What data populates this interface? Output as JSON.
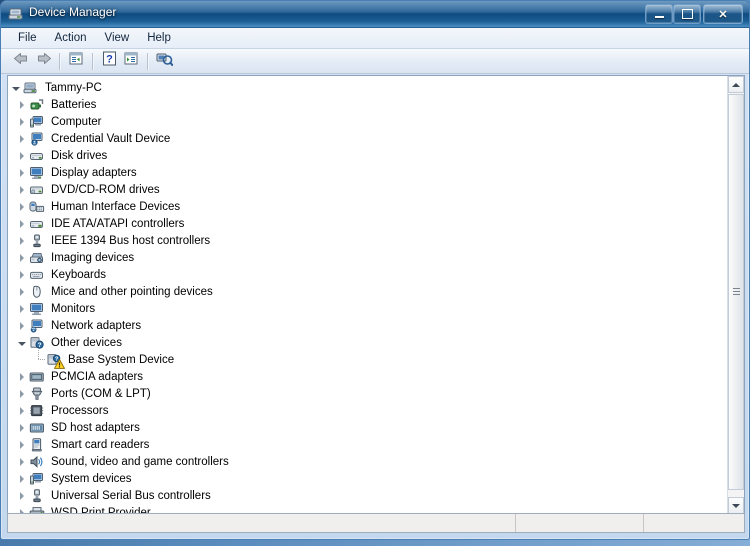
{
  "window": {
    "title": "Device Manager",
    "title_icon": "device-manager-icon",
    "buttons": {
      "minimize": "minimize-icon",
      "maximize": "maximize-icon",
      "close": "✕"
    }
  },
  "menubar": {
    "items": [
      {
        "label": "File"
      },
      {
        "label": "Action"
      },
      {
        "label": "View"
      },
      {
        "label": "Help"
      }
    ]
  },
  "toolbar": {
    "buttons": [
      {
        "name": "back-button",
        "icon": "back-arrow-icon"
      },
      {
        "name": "forward-button",
        "icon": "forward-arrow-icon"
      },
      {
        "name": "properties-button",
        "icon": "properties-icon"
      },
      {
        "name": "help-button",
        "icon": "help-question-icon"
      },
      {
        "name": "show-hidden-button",
        "icon": "list-panel-icon"
      },
      {
        "name": "scan-hardware-button",
        "icon": "scan-hardware-icon"
      }
    ]
  },
  "tree": {
    "root": {
      "label": "Tammy-PC",
      "icon": "computer-root-icon",
      "expanded": true
    },
    "nodes": [
      {
        "label": "Batteries",
        "icon": "battery-icon",
        "expanded": false,
        "leaf": false
      },
      {
        "label": "Computer",
        "icon": "computer-icon",
        "expanded": false,
        "leaf": false
      },
      {
        "label": "Credential Vault Device",
        "icon": "credential-icon",
        "expanded": false,
        "leaf": false
      },
      {
        "label": "Disk drives",
        "icon": "disk-drive-icon",
        "expanded": false,
        "leaf": false
      },
      {
        "label": "Display adapters",
        "icon": "display-icon",
        "expanded": false,
        "leaf": false
      },
      {
        "label": "DVD/CD-ROM drives",
        "icon": "dvd-icon",
        "expanded": false,
        "leaf": false
      },
      {
        "label": "Human Interface Devices",
        "icon": "hid-icon",
        "expanded": false,
        "leaf": false
      },
      {
        "label": "IDE ATA/ATAPI controllers",
        "icon": "ide-icon",
        "expanded": false,
        "leaf": false
      },
      {
        "label": "IEEE 1394 Bus host controllers",
        "icon": "ieee1394-icon",
        "expanded": false,
        "leaf": false
      },
      {
        "label": "Imaging devices",
        "icon": "imaging-icon",
        "expanded": false,
        "leaf": false
      },
      {
        "label": "Keyboards",
        "icon": "keyboard-icon",
        "expanded": false,
        "leaf": false
      },
      {
        "label": "Mice and other pointing devices",
        "icon": "mouse-icon",
        "expanded": false,
        "leaf": false
      },
      {
        "label": "Monitors",
        "icon": "monitor-icon",
        "expanded": false,
        "leaf": false
      },
      {
        "label": "Network adapters",
        "icon": "network-icon",
        "expanded": false,
        "leaf": false
      },
      {
        "label": "Other devices",
        "icon": "other-devices-icon",
        "expanded": true,
        "leaf": false
      },
      {
        "label": "Base System Device",
        "icon": "unknown-device-icon",
        "expanded": false,
        "leaf": true,
        "child": true,
        "warning": true
      },
      {
        "label": "PCMCIA adapters",
        "icon": "pcmcia-icon",
        "expanded": false,
        "leaf": false
      },
      {
        "label": "Ports (COM & LPT)",
        "icon": "port-icon",
        "expanded": false,
        "leaf": false
      },
      {
        "label": "Processors",
        "icon": "processor-icon",
        "expanded": false,
        "leaf": false
      },
      {
        "label": "SD host adapters",
        "icon": "sd-host-icon",
        "expanded": false,
        "leaf": false
      },
      {
        "label": "Smart card readers",
        "icon": "smartcard-icon",
        "expanded": false,
        "leaf": false
      },
      {
        "label": "Sound, video and game controllers",
        "icon": "sound-icon",
        "expanded": false,
        "leaf": false
      },
      {
        "label": "System devices",
        "icon": "system-devices-icon",
        "expanded": false,
        "leaf": false
      },
      {
        "label": "Universal Serial Bus controllers",
        "icon": "usb-icon",
        "expanded": false,
        "leaf": false
      },
      {
        "label": "WSD Print Provider",
        "icon": "printer-icon",
        "expanded": false,
        "leaf": false
      }
    ]
  },
  "statusbar": {
    "main": "",
    "pane2": "",
    "pane3": ""
  },
  "colors": {
    "title_bar": "#1f5c92",
    "accent": "#2f6ea4",
    "warning": "#ffd42a",
    "tree_bg": "#ffffff",
    "toolbar_bg": "#e3ebf5"
  }
}
